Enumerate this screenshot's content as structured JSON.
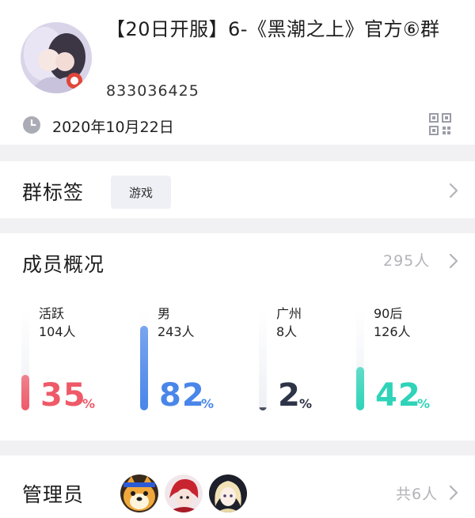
{
  "group": {
    "name": "【20日开服】6-《黑潮之上》官方⑥群",
    "id": "833036425",
    "created": "2020年10月22日"
  },
  "tags": {
    "title": "群标签",
    "items": [
      "游戏"
    ]
  },
  "members": {
    "title": "成员概况",
    "total": "295人",
    "stats": [
      {
        "label": "活跃",
        "count": "104人",
        "percent": 35,
        "percent_text": "35",
        "color": "#ee5a68"
      },
      {
        "label": "男",
        "count": "243人",
        "percent": 82,
        "percent_text": "82",
        "color": "#4a86ea"
      },
      {
        "label": "广州",
        "count": "8人",
        "percent": 2,
        "percent_text": "2",
        "color": "#2e3448"
      },
      {
        "label": "90后",
        "count": "126人",
        "percent": 42,
        "percent_text": "42",
        "color": "#2ed3b8"
      }
    ],
    "percent_sign": "%"
  },
  "admins": {
    "title": "管理员",
    "count": "共6人",
    "avatars": [
      "shiba-dog-avatar",
      "red-hair-character-avatar",
      "blonde-character-avatar"
    ]
  },
  "icons": [
    "clock-icon",
    "qr-code-icon",
    "chevron-right-icon"
  ]
}
